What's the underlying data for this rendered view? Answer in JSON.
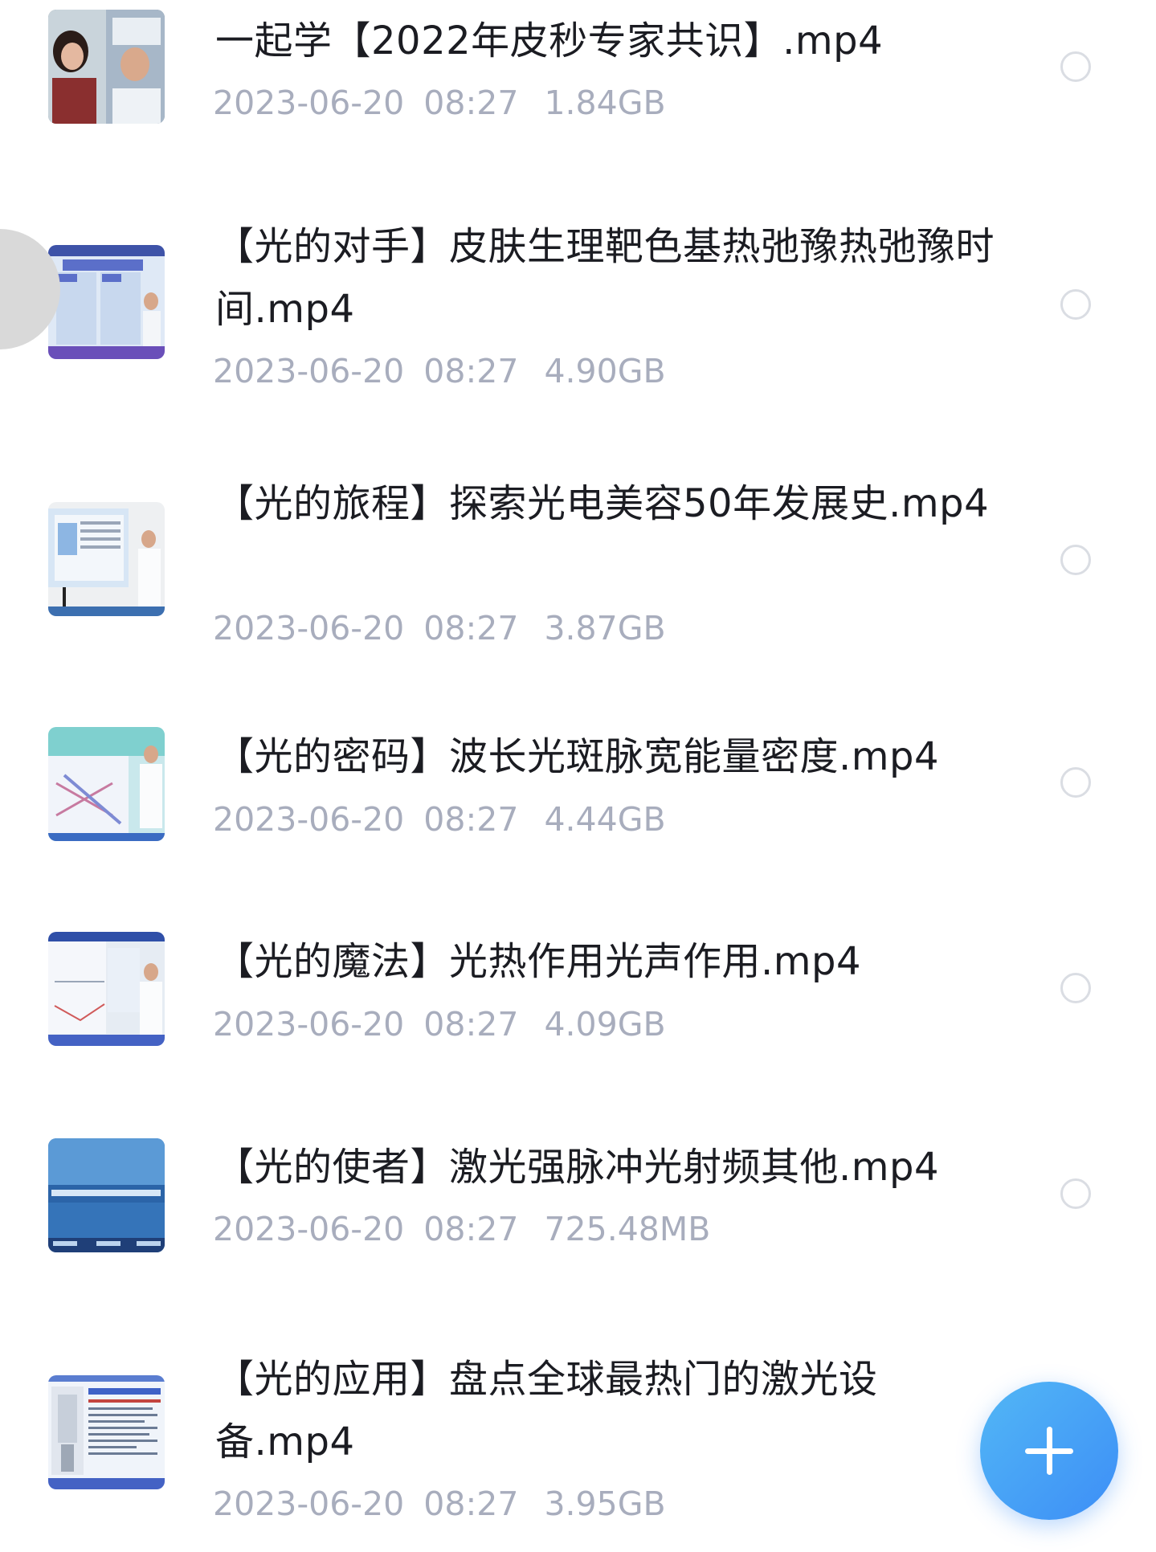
{
  "files": [
    {
      "title": "一起学【2022年皮秒专家共识】.mp4",
      "date": "2023-06-20",
      "time": "08:27",
      "size": "1.84GB",
      "thumbnail_icon": "video-thumbnail-meeting"
    },
    {
      "title": "【光的对手】皮肤生理靶色基热弛豫热弛豫时间.mp4",
      "date": "2023-06-20",
      "time": "08:27",
      "size": "4.90GB",
      "thumbnail_icon": "video-thumbnail-lecture"
    },
    {
      "title": "【光的旅程】探索光电美容50年发展史.mp4",
      "date": "2023-06-20",
      "time": "08:27",
      "size": "3.87GB",
      "thumbnail_icon": "video-thumbnail-lecture"
    },
    {
      "title": "【光的密码】波长光斑脉宽能量密度.mp4",
      "date": "2023-06-20",
      "time": "08:27",
      "size": "4.44GB",
      "thumbnail_icon": "video-thumbnail-lecture"
    },
    {
      "title": "【光的魔法】光热作用光声作用.mp4",
      "date": "2023-06-20",
      "time": "08:27",
      "size": "4.09GB",
      "thumbnail_icon": "video-thumbnail-lecture"
    },
    {
      "title": "【光的使者】激光强脉冲光射频其他.mp4",
      "date": "2023-06-20",
      "time": "08:27",
      "size": "725.48MB",
      "thumbnail_icon": "video-thumbnail-slide"
    },
    {
      "title": "【光的应用】盘点全球最热门的激光设备.mp4",
      "date": "2023-06-20",
      "time": "08:27",
      "size": "3.95GB",
      "thumbnail_icon": "video-thumbnail-device"
    }
  ],
  "fab": {
    "icon": "plus-icon",
    "color": "#3d8ef7"
  },
  "colors": {
    "title": "#1b1c22",
    "meta": "#a8adbd",
    "radio": "#dadde3"
  }
}
